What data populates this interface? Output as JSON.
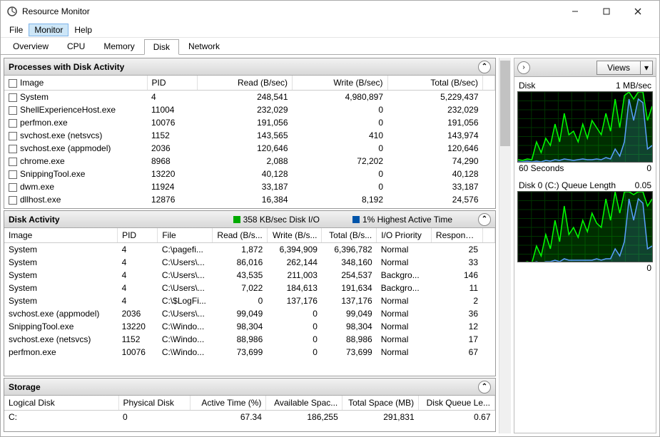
{
  "window": {
    "title": "Resource Monitor"
  },
  "menu": {
    "items": [
      "File",
      "Monitor",
      "Help"
    ],
    "active": 1
  },
  "tabs": {
    "items": [
      "Overview",
      "CPU",
      "Memory",
      "Disk",
      "Network"
    ],
    "active": 3
  },
  "views_label": "Views",
  "panels": {
    "p1": {
      "title": "Processes with Disk Activity",
      "columns": [
        "Image",
        "PID",
        "Read (B/sec)",
        "Write (B/sec)",
        "Total (B/sec)"
      ],
      "rows": [
        {
          "img": "System",
          "pid": "4",
          "read": "248,541",
          "write": "4,980,897",
          "total": "5,229,437"
        },
        {
          "img": "ShellExperienceHost.exe",
          "pid": "11004",
          "read": "232,029",
          "write": "0",
          "total": "232,029"
        },
        {
          "img": "perfmon.exe",
          "pid": "10076",
          "read": "191,056",
          "write": "0",
          "total": "191,056"
        },
        {
          "img": "svchost.exe (netsvcs)",
          "pid": "1152",
          "read": "143,565",
          "write": "410",
          "total": "143,974"
        },
        {
          "img": "svchost.exe (appmodel)",
          "pid": "2036",
          "read": "120,646",
          "write": "0",
          "total": "120,646"
        },
        {
          "img": "chrome.exe",
          "pid": "8968",
          "read": "2,088",
          "write": "72,202",
          "total": "74,290"
        },
        {
          "img": "SnippingTool.exe",
          "pid": "13220",
          "read": "40,128",
          "write": "0",
          "total": "40,128"
        },
        {
          "img": "dwm.exe",
          "pid": "11924",
          "read": "33,187",
          "write": "0",
          "total": "33,187"
        },
        {
          "img": "dllhost.exe",
          "pid": "12876",
          "read": "16,384",
          "write": "8,192",
          "total": "24,576"
        }
      ]
    },
    "p2": {
      "title": "Disk Activity",
      "stat1": "358 KB/sec Disk I/O",
      "stat2": "1% Highest Active Time",
      "columns": [
        "Image",
        "PID",
        "File",
        "Read (B/s...",
        "Write (B/s...",
        "Total (B/s...",
        "I/O Priority",
        "Response..."
      ],
      "rows": [
        {
          "c": [
            "System",
            "4",
            "C:\\pagefi...",
            "1,872",
            "6,394,909",
            "6,396,782",
            "Normal",
            "25"
          ]
        },
        {
          "c": [
            "System",
            "4",
            "C:\\Users\\...",
            "86,016",
            "262,144",
            "348,160",
            "Normal",
            "33"
          ]
        },
        {
          "c": [
            "System",
            "4",
            "C:\\Users\\...",
            "43,535",
            "211,003",
            "254,537",
            "Backgro...",
            "146"
          ]
        },
        {
          "c": [
            "System",
            "4",
            "C:\\Users\\...",
            "7,022",
            "184,613",
            "191,634",
            "Backgro...",
            "11"
          ]
        },
        {
          "c": [
            "System",
            "4",
            "C:\\$LogFi...",
            "0",
            "137,176",
            "137,176",
            "Normal",
            "2"
          ]
        },
        {
          "c": [
            "svchost.exe (appmodel)",
            "2036",
            "C:\\Users\\...",
            "99,049",
            "0",
            "99,049",
            "Normal",
            "36"
          ]
        },
        {
          "c": [
            "SnippingTool.exe",
            "13220",
            "C:\\Windo...",
            "98,304",
            "0",
            "98,304",
            "Normal",
            "12"
          ]
        },
        {
          "c": [
            "svchost.exe (netsvcs)",
            "1152",
            "C:\\Windo...",
            "88,986",
            "0",
            "88,986",
            "Normal",
            "17"
          ]
        },
        {
          "c": [
            "perfmon.exe",
            "10076",
            "C:\\Windo...",
            "73,699",
            "0",
            "73,699",
            "Normal",
            "67"
          ]
        }
      ]
    },
    "p3": {
      "title": "Storage",
      "columns": [
        "Logical Disk",
        "Physical Disk",
        "Active Time (%)",
        "Available Spac...",
        "Total Space (MB)",
        "Disk Queue Le..."
      ],
      "rows": [
        {
          "c": [
            "C:",
            "0",
            "67.34",
            "186,255",
            "291,831",
            "0.67"
          ]
        }
      ]
    }
  },
  "charts": {
    "c1": {
      "left": "Disk",
      "right": "1 MB/sec",
      "bottomleft": "60 Seconds",
      "bottomright": "0"
    },
    "c2": {
      "left": "Disk 0 (C:) Queue Length",
      "right": "0.05",
      "bottomright": "0"
    }
  },
  "chart_data": [
    {
      "type": "area",
      "title": "Disk",
      "ylabel": "MB/sec",
      "ylim": [
        0,
        1
      ],
      "x_seconds": 60,
      "series": [
        {
          "name": "total",
          "color": "#00ff00",
          "values": [
            0.05,
            0.04,
            0.06,
            0.05,
            0.3,
            0.15,
            0.35,
            0.25,
            0.55,
            0.3,
            0.7,
            0.4,
            0.45,
            0.3,
            0.55,
            0.35,
            0.6,
            0.5,
            0.4,
            0.7,
            0.45,
            0.9,
            0.5,
            0.95,
            1.0,
            0.9,
            1.0,
            1.0,
            0.6,
            0.8
          ]
        },
        {
          "name": "io",
          "color": "#5aa0ff",
          "values": [
            0.02,
            0.02,
            0.03,
            0.02,
            0.03,
            0.02,
            0.04,
            0.03,
            0.05,
            0.04,
            0.06,
            0.05,
            0.04,
            0.05,
            0.06,
            0.05,
            0.05,
            0.06,
            0.05,
            0.08,
            0.06,
            0.2,
            0.1,
            0.3,
            0.9,
            0.6,
            0.9,
            0.85,
            0.2,
            0.25
          ]
        }
      ]
    },
    {
      "type": "area",
      "title": "Disk 0 (C:) Queue Length",
      "ylim": [
        0,
        0.05
      ],
      "x_seconds": 60,
      "series": [
        {
          "name": "queue",
          "color": "#00ff00",
          "values": [
            0.0,
            0.0,
            0.001,
            0.0,
            0.012,
            0.005,
            0.02,
            0.01,
            0.03,
            0.015,
            0.04,
            0.02,
            0.025,
            0.018,
            0.03,
            0.022,
            0.035,
            0.028,
            0.025,
            0.045,
            0.03,
            0.05,
            0.035,
            0.05,
            0.05,
            0.048,
            0.05,
            0.05,
            0.04,
            0.045
          ]
        },
        {
          "name": "overlay",
          "color": "#5aa0ff",
          "values": [
            0.0,
            0.0,
            0.0,
            0.0,
            0.001,
            0.0,
            0.001,
            0.001,
            0.002,
            0.001,
            0.003,
            0.002,
            0.002,
            0.002,
            0.002,
            0.002,
            0.002,
            0.003,
            0.002,
            0.003,
            0.003,
            0.01,
            0.005,
            0.015,
            0.045,
            0.03,
            0.045,
            0.042,
            0.01,
            0.012
          ]
        }
      ]
    }
  ]
}
